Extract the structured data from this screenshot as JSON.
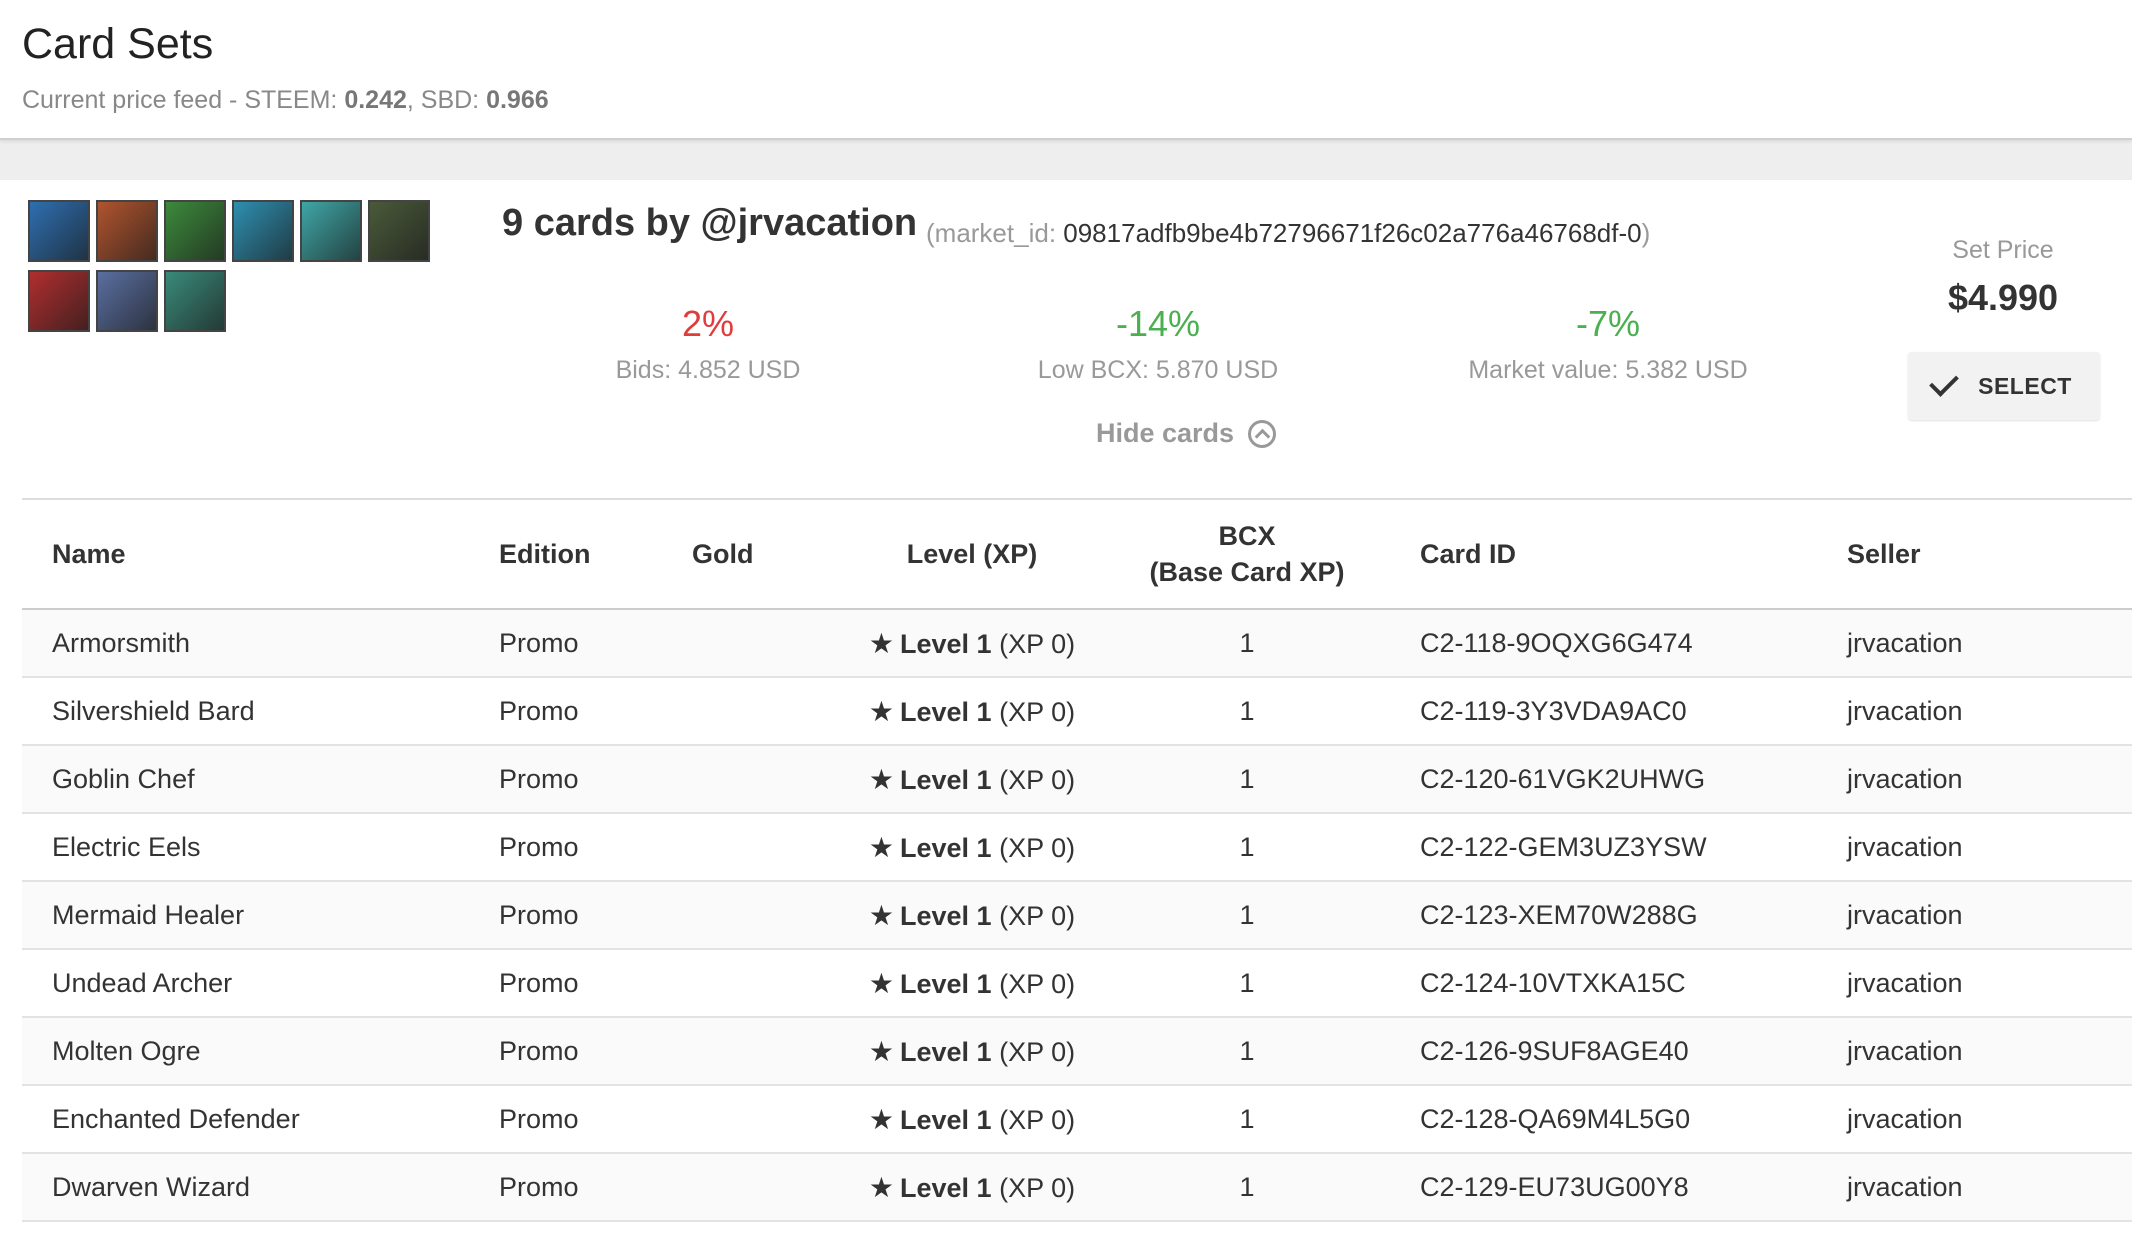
{
  "header": {
    "title": "Card Sets",
    "feed_prefix": "Current price feed - STEEM: ",
    "steem": "0.242",
    "sbd_prefix": ", SBD: ",
    "sbd": "0.966"
  },
  "set": {
    "title": "9 cards by @jrvacation",
    "market_label": "(market_id: ",
    "market_id": "09817adfb9be4b72796671f26c02a776a46768df-0",
    "market_close": ")",
    "stats": [
      {
        "pct": "2%",
        "label": "Bids: 4.852 USD",
        "color": "#e03c3c"
      },
      {
        "pct": "-14%",
        "label": "Low BCX: 5.870 USD",
        "color": "#4caf50"
      },
      {
        "pct": "-7%",
        "label": "Market value: 5.382 USD",
        "color": "#4caf50"
      }
    ],
    "hide_cards": "Hide cards",
    "price_caption": "Set Price",
    "price": "$4.990",
    "select_label": "SELECT",
    "thumb_colors": [
      "#2e6fb0",
      "#b0542e",
      "#3c8a3c",
      "#2e8fb0",
      "#3fa6a6",
      "#4a5a3a",
      "#b02e2e",
      "#5a6fa0",
      "#3a8a7a"
    ]
  },
  "table": {
    "headers": {
      "name": "Name",
      "edition": "Edition",
      "gold": "Gold",
      "level": "Level (XP)",
      "bcx": "BCX",
      "bcx_sub": "(Base Card XP)",
      "card_id": "Card ID",
      "seller": "Seller"
    },
    "rows": [
      {
        "name": "Armorsmith",
        "edition": "Promo",
        "level": "Level 1",
        "xp": "(XP 0)",
        "bcx": "1",
        "card_id": "C2-118-9OQXG6G474",
        "seller": "jrvacation"
      },
      {
        "name": "Silvershield Bard",
        "edition": "Promo",
        "level": "Level 1",
        "xp": "(XP 0)",
        "bcx": "1",
        "card_id": "C2-119-3Y3VDA9AC0",
        "seller": "jrvacation"
      },
      {
        "name": "Goblin Chef",
        "edition": "Promo",
        "level": "Level 1",
        "xp": "(XP 0)",
        "bcx": "1",
        "card_id": "C2-120-61VGK2UHWG",
        "seller": "jrvacation"
      },
      {
        "name": "Electric Eels",
        "edition": "Promo",
        "level": "Level 1",
        "xp": "(XP 0)",
        "bcx": "1",
        "card_id": "C2-122-GEM3UZ3YSW",
        "seller": "jrvacation"
      },
      {
        "name": "Mermaid Healer",
        "edition": "Promo",
        "level": "Level 1",
        "xp": "(XP 0)",
        "bcx": "1",
        "card_id": "C2-123-XEM70W288G",
        "seller": "jrvacation"
      },
      {
        "name": "Undead Archer",
        "edition": "Promo",
        "level": "Level 1",
        "xp": "(XP 0)",
        "bcx": "1",
        "card_id": "C2-124-10VTXKA15C",
        "seller": "jrvacation"
      },
      {
        "name": "Molten Ogre",
        "edition": "Promo",
        "level": "Level 1",
        "xp": "(XP 0)",
        "bcx": "1",
        "card_id": "C2-126-9SUF8AGE40",
        "seller": "jrvacation"
      },
      {
        "name": "Enchanted Defender",
        "edition": "Promo",
        "level": "Level 1",
        "xp": "(XP 0)",
        "bcx": "1",
        "card_id": "C2-128-QA69M4L5G0",
        "seller": "jrvacation"
      },
      {
        "name": "Dwarven Wizard",
        "edition": "Promo",
        "level": "Level 1",
        "xp": "(XP 0)",
        "bcx": "1",
        "card_id": "C2-129-EU73UG00Y8",
        "seller": "jrvacation"
      }
    ]
  }
}
